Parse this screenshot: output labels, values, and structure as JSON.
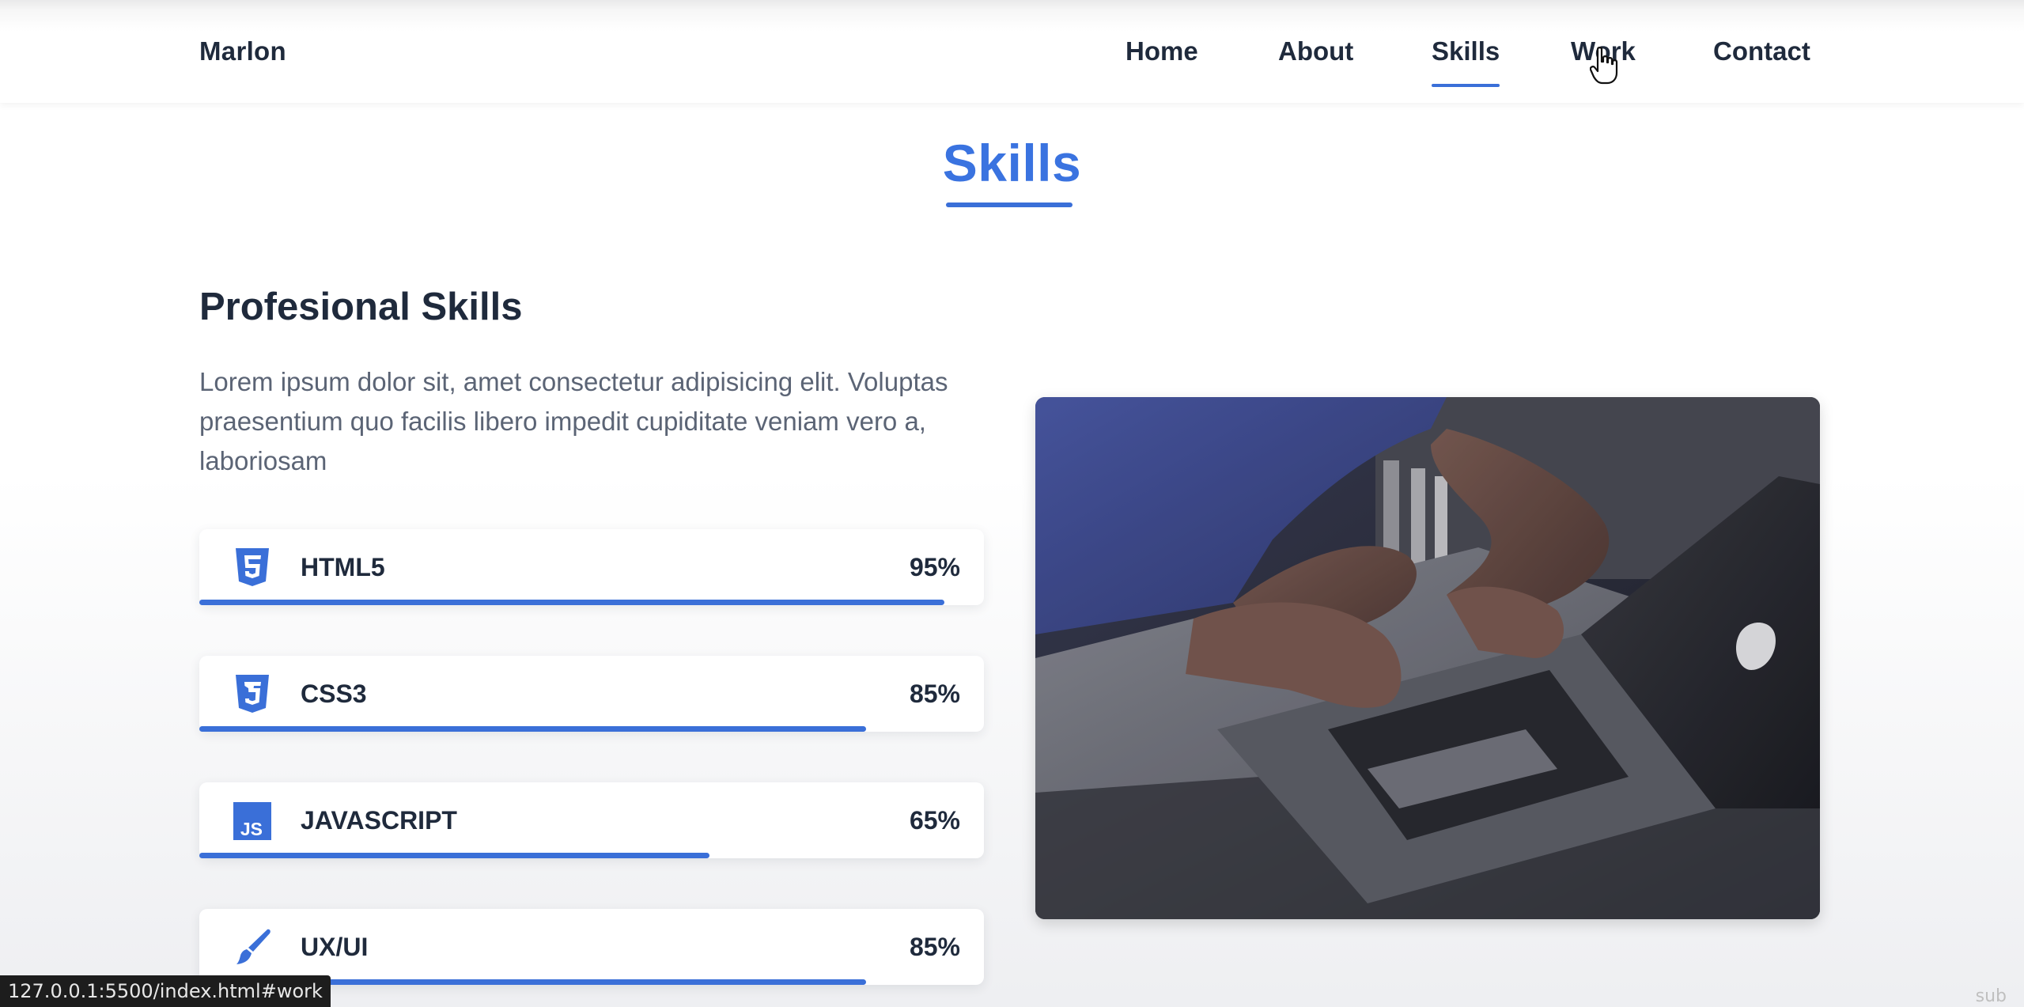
{
  "header": {
    "logo": "Marlon",
    "nav": [
      {
        "label": "Home"
      },
      {
        "label": "About"
      },
      {
        "label": "Skills"
      },
      {
        "label": "Work"
      },
      {
        "label": "Contact"
      }
    ],
    "active_item": "Skills"
  },
  "section": {
    "title": "Skills",
    "subtitle": "Profesional Skills",
    "description": "Lorem ipsum dolor sit, amet consectetur adipisicing elit. Voluptas praesentium quo facilis libero impedit cupiditate veniam vero a, laboriosam",
    "skills": [
      {
        "name": "HTML5",
        "percent_label": "95%",
        "level": 95,
        "icon": "html5-icon"
      },
      {
        "name": "CSS3",
        "percent_label": "85%",
        "level": 85,
        "icon": "css3-icon"
      },
      {
        "name": "JAVASCRIPT",
        "percent_label": "65%",
        "level": 65,
        "icon": "javascript-icon"
      },
      {
        "name": "UX/UI",
        "percent_label": "85%",
        "level": 85,
        "icon": "brush-icon"
      }
    ],
    "image": "laptop-typing-photo"
  },
  "status_bar": {
    "url": "127.0.0.1:5500/index.html#work"
  },
  "corner_label": "sub",
  "colors": {
    "accent": "#3a6fd8",
    "title": "#3a73e0",
    "text_dark": "#1f2a3c",
    "text_muted": "#5b6475"
  }
}
